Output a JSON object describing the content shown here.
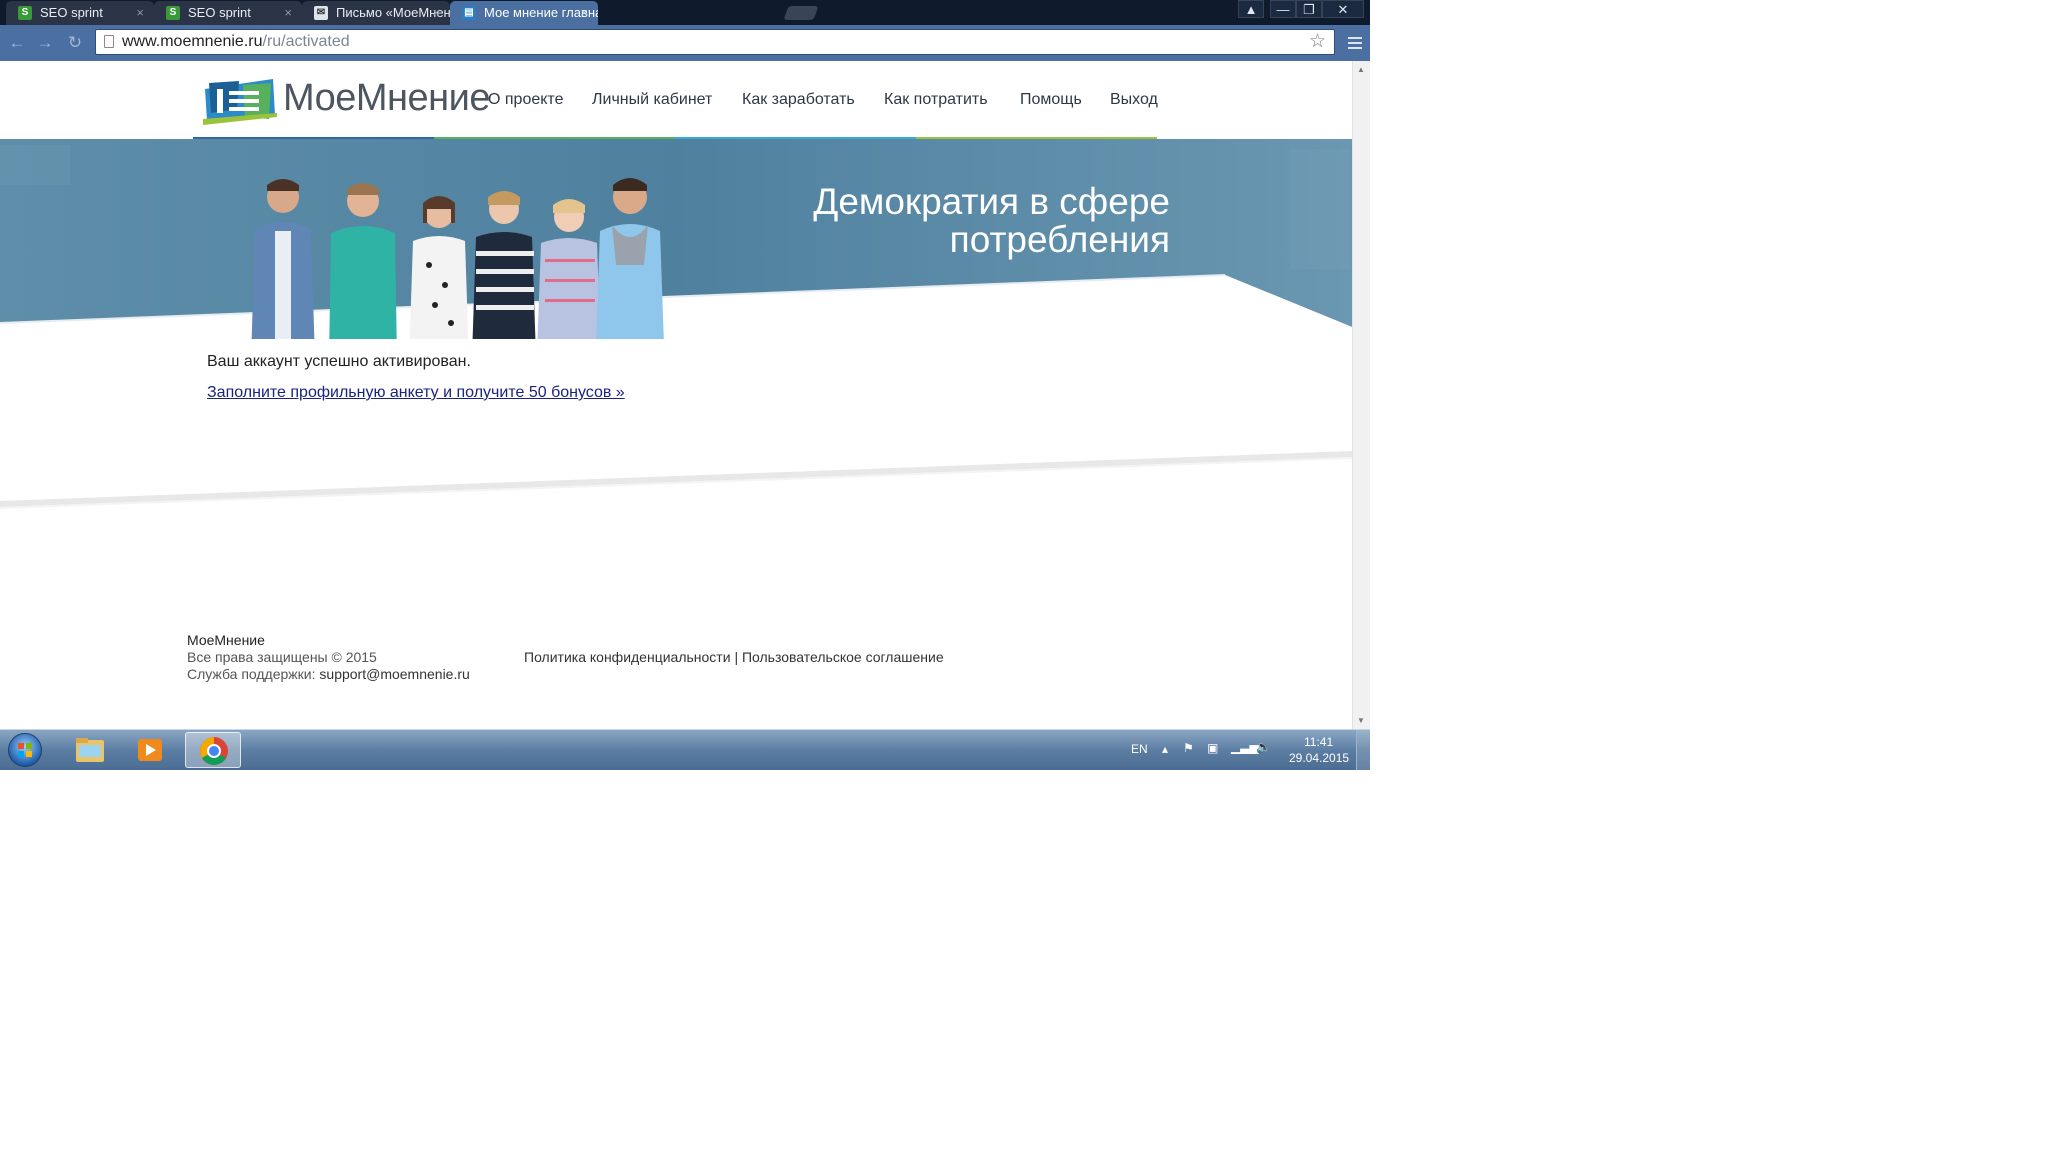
{
  "browser": {
    "tabs": [
      {
        "title": "SEO sprint",
        "favicon": "seo-sprint-favicon",
        "active": false
      },
      {
        "title": "SEO sprint",
        "favicon": "seo-sprint-favicon",
        "active": false
      },
      {
        "title": "Письмо «МоеМнение: п",
        "favicon": "mail-favicon",
        "active": false
      },
      {
        "title": "Мое мнение главная",
        "favicon": "moemnenie-favicon",
        "active": true
      }
    ],
    "address": {
      "domain": "www.moemnenie.ru",
      "path": "/ru/activated"
    },
    "controls": {
      "minimize": "—",
      "restore": "❐",
      "close": "✕",
      "user": "👤"
    }
  },
  "site": {
    "logo_text": "МоеМнение",
    "nav": [
      "О проекте",
      "Личный кабинет",
      "Как заработать",
      "Как потратить",
      "Помощь",
      "Выход"
    ],
    "hero": {
      "line1": "Демократия в сфере",
      "line2": "потребления"
    },
    "message": "Ваш аккаунт успешно активирован.",
    "cta_link": "Заполните профильную анкету и получите 50 бонусов »",
    "footer": {
      "brand": "МоеМнение",
      "copyright": "Все права защищены © 2015",
      "support_label": "Служба поддержки:",
      "support_email": "support@moemnenie.ru",
      "privacy": "Политика конфиденциальности",
      "separator": "|",
      "agreement": "Пользовательское соглашение"
    },
    "colors": {
      "hero_blue": "#5a8aa6",
      "strip_blue": "#2c6aa0",
      "strip_green": "#56b05c",
      "strip_lightblue": "#38a9d8",
      "strip_lime": "#9ac23c",
      "link": "#1a237e"
    }
  },
  "taskbar": {
    "language": "EN",
    "time": "11:41",
    "date": "29.04.2015"
  }
}
